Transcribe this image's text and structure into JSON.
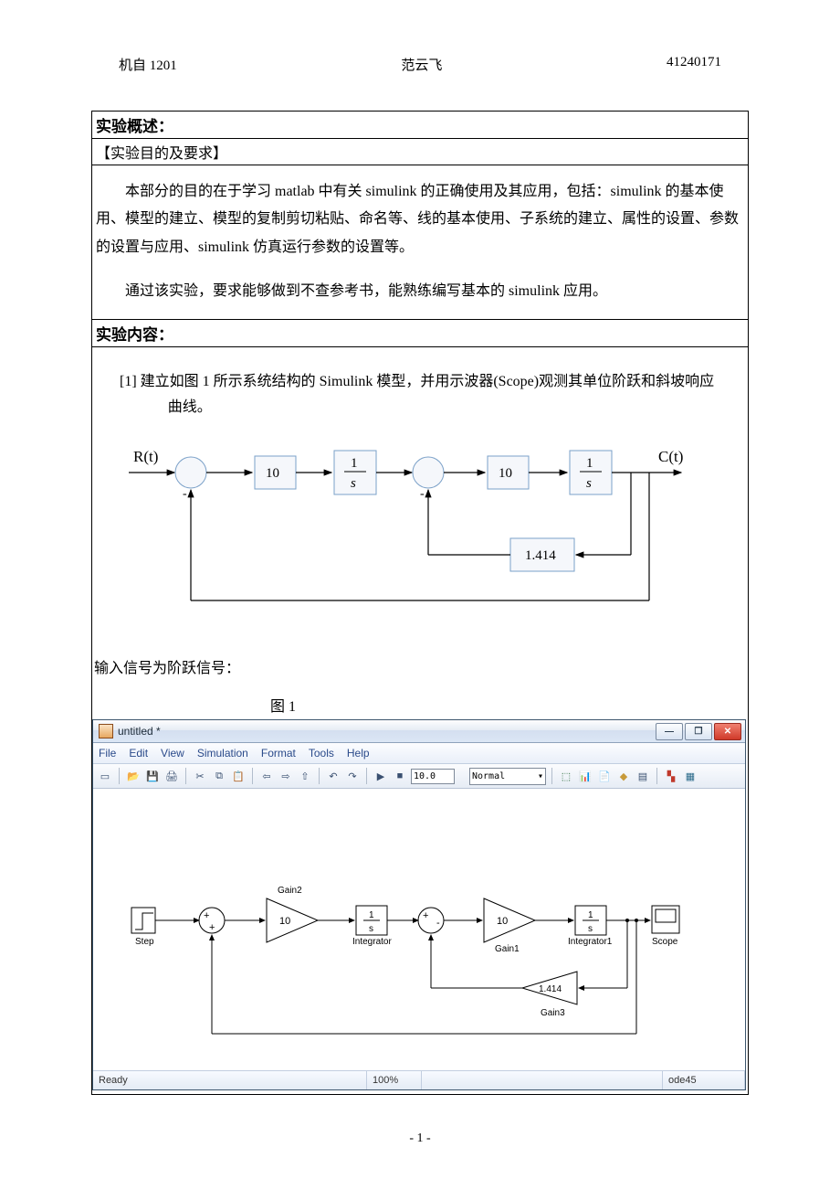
{
  "header": {
    "left": "机自 1201",
    "center": "范云飞",
    "right": "41240171"
  },
  "sec1_title": "实验概述：",
  "sec1_sub": "【实验目的及要求】",
  "sec1_p1": "本部分的目的在于学习 matlab 中有关 simulink 的正确使用及其应用，包括：simulink 的基本使用、模型的建立、模型的复制剪切粘贴、命名等、线的基本使用、子系统的建立、属性的设置、参数的设置与应用、simulink 仿真运行参数的设置等。",
  "sec1_p2": "通过该实验，要求能够做到不查参考书，能熟练编写基本的 simulink 应用。",
  "sec2_title": "实验内容：",
  "sec2_task": "[1] 建立如图 1 所示系统结构的 Simulink 模型，并用示波器(Scope)观测其单位阶跃和斜坡响应曲线。",
  "diagram": {
    "input_label": "R(t)",
    "output_label": "C(t)",
    "gain1": "10",
    "integ": "s",
    "integ_num": "1",
    "gain2": "10",
    "fb_gain": "1.414",
    "minus": "-"
  },
  "input_line": "输入信号为阶跃信号：",
  "fig_caption": "图  1",
  "sim": {
    "title": "untitled *",
    "menu": [
      "File",
      "Edit",
      "View",
      "Simulation",
      "Format",
      "Tools",
      "Help"
    ],
    "stoptime": "10.0",
    "mode": "Normal",
    "blocks": {
      "step": "Step",
      "gain2": "Gain2",
      "g2v": "10",
      "int": "Integrator",
      "intv": "s",
      "intnum": "1",
      "gain1": "Gain1",
      "g1v": "10",
      "int1": "Integrator1",
      "scope": "Scope",
      "gain3": "Gain3",
      "g3v": "1.414"
    },
    "status": {
      "ready": "Ready",
      "zoom": "100%",
      "solver": "ode45"
    }
  },
  "page_num": "- 1 -"
}
